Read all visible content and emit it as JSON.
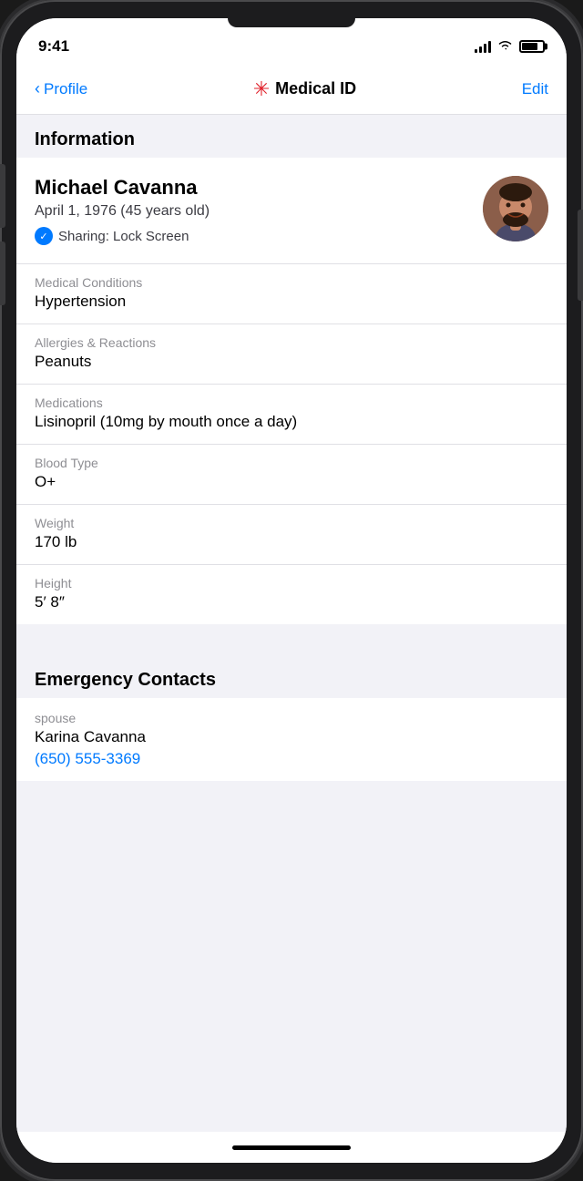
{
  "statusBar": {
    "time": "9:41"
  },
  "navbar": {
    "back_label": "Profile",
    "title_text": "Medical ID",
    "title_asterisk": "✳",
    "edit_label": "Edit"
  },
  "sections": {
    "information_header": "Information",
    "emergency_contacts_header": "Emergency Contacts"
  },
  "profile": {
    "name": "Michael Cavanna",
    "dob": "April 1, 1976 (45 years old)",
    "sharing": "Sharing: Lock Screen"
  },
  "fields": {
    "medical_conditions_label": "Medical Conditions",
    "medical_conditions_value": "Hypertension",
    "allergies_label": "Allergies & Reactions",
    "allergies_value": "Peanuts",
    "medications_label": "Medications",
    "medications_value": "Lisinopril (10mg by mouth once a day)",
    "blood_type_label": "Blood Type",
    "blood_type_value": "O+",
    "weight_label": "Weight",
    "weight_value": "170 lb",
    "height_label": "Height",
    "height_value": "5′ 8″"
  },
  "emergency_contact": {
    "relation": "spouse",
    "name": "Karina Cavanna",
    "phone": "(650) 555-3369"
  }
}
